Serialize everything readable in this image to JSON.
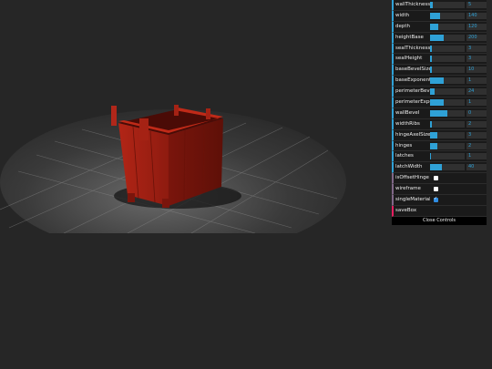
{
  "controls": [
    {
      "label": "wallThickness",
      "type": "slider",
      "value": "5",
      "fill": 0.08
    },
    {
      "label": "width",
      "type": "slider",
      "value": "140",
      "fill": 0.28
    },
    {
      "label": "depth",
      "type": "slider",
      "value": "120",
      "fill": 0.24
    },
    {
      "label": "heightBase",
      "type": "slider",
      "value": "200",
      "fill": 0.4
    },
    {
      "label": "sealThickness",
      "type": "slider",
      "value": "3",
      "fill": 0.05
    },
    {
      "label": "sealHeight",
      "type": "slider",
      "value": "3",
      "fill": 0.05
    },
    {
      "label": "baseBevelSize",
      "type": "slider",
      "value": "10",
      "fill": 0.06
    },
    {
      "label": "baseExponent",
      "type": "slider",
      "value": "1",
      "fill": 0.4
    },
    {
      "label": "perimeterBevelS…",
      "type": "slider",
      "value": "24",
      "fill": 0.12
    },
    {
      "label": "perimeterExpone",
      "type": "slider",
      "value": "1",
      "fill": 0.4
    },
    {
      "label": "wallBevel",
      "type": "slider",
      "value": "0",
      "fill": 0.5
    },
    {
      "label": "widthRibs",
      "type": "slider",
      "value": "2",
      "fill": 0.04
    },
    {
      "label": "hingeAxelSize",
      "type": "slider",
      "value": "3",
      "fill": 0.22
    },
    {
      "label": "hinges",
      "type": "slider",
      "value": "2",
      "fill": 0.2
    },
    {
      "label": "latches",
      "type": "slider",
      "value": "1",
      "fill": 0.02
    },
    {
      "label": "latchWidth",
      "type": "slider",
      "value": "40",
      "fill": 0.34
    },
    {
      "label": "isOffsetHinge",
      "type": "checkbox",
      "checked": false
    },
    {
      "label": "wireframe",
      "type": "checkbox",
      "checked": false
    },
    {
      "label": "singleMaterial",
      "type": "checkbox",
      "checked": true
    },
    {
      "label": "saveBox",
      "type": "button"
    }
  ],
  "close_label": "Close Controls",
  "colors": {
    "slider": "#2fa1d6",
    "box": "#a11d12",
    "background": "#262626"
  }
}
